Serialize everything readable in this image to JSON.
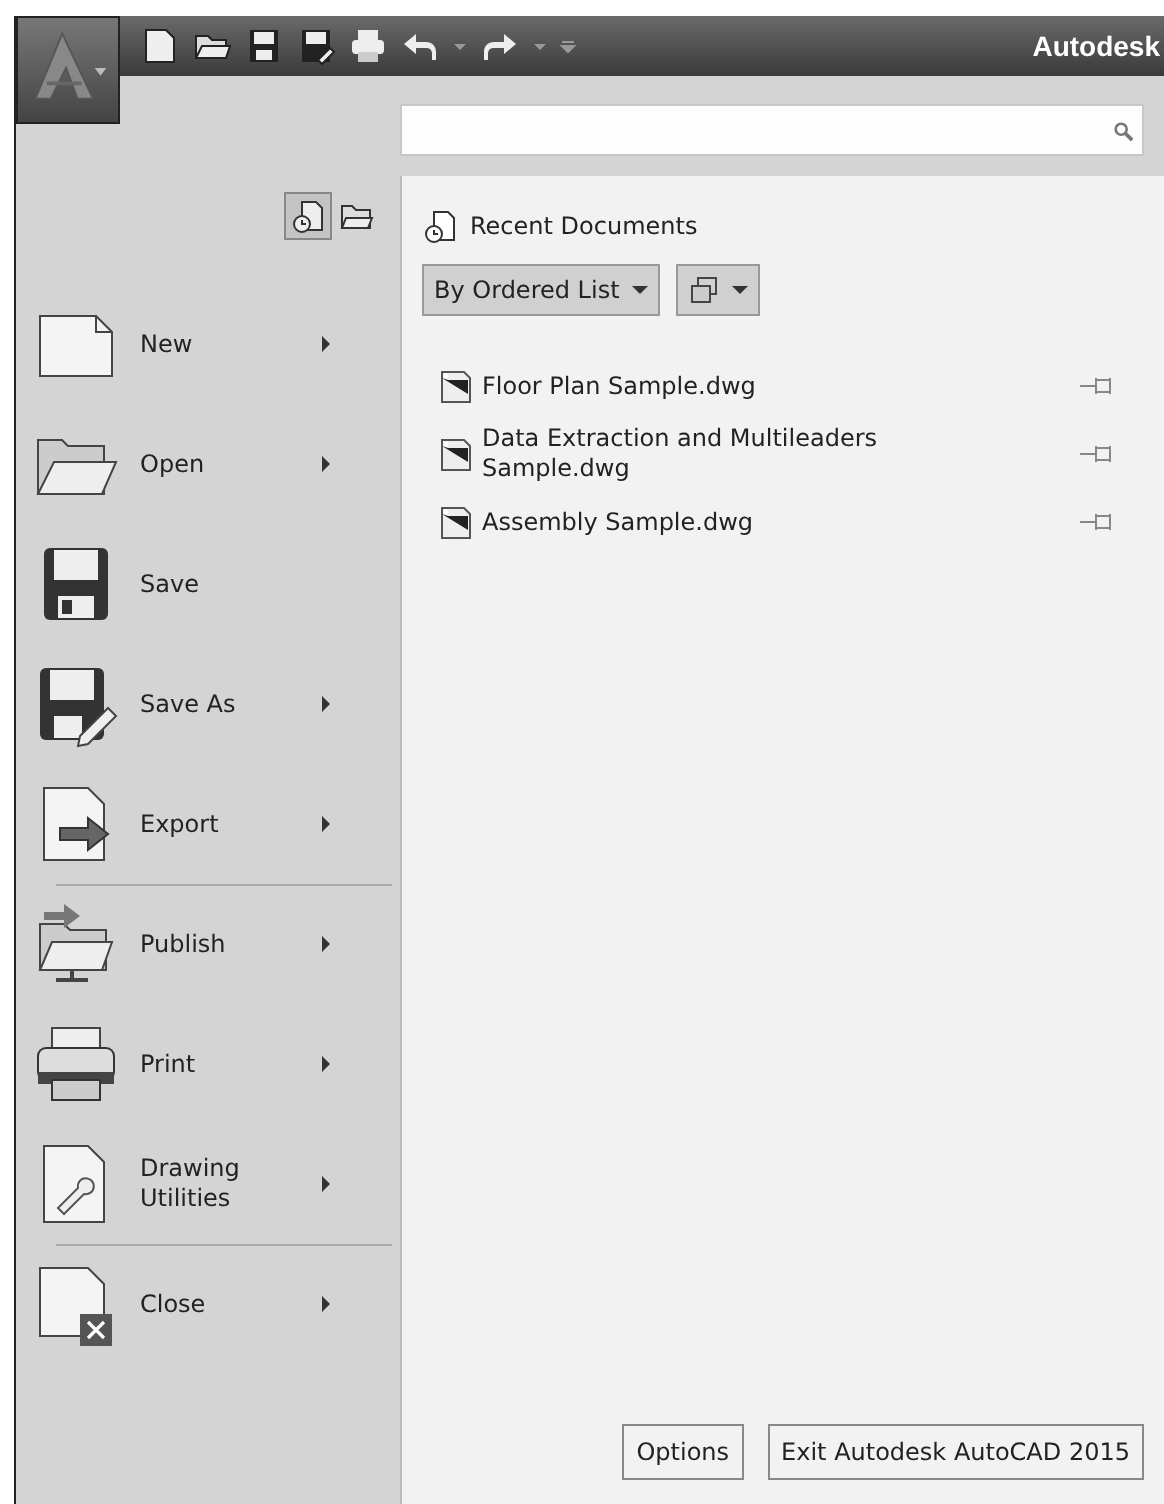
{
  "title_bar": {
    "title": "Autodesk"
  },
  "view_toggle": [
    {
      "kind": "recent",
      "selected": true
    },
    {
      "kind": "open",
      "selected": false
    }
  ],
  "menu": [
    {
      "kind": "new",
      "label": "New",
      "submenu": true,
      "separator_before": false
    },
    {
      "kind": "open",
      "label": "Open",
      "submenu": true,
      "separator_before": false
    },
    {
      "kind": "save",
      "label": "Save",
      "submenu": false,
      "separator_before": false
    },
    {
      "kind": "saveas",
      "label": "Save As",
      "submenu": true,
      "separator_before": false
    },
    {
      "kind": "export",
      "label": "Export",
      "submenu": true,
      "separator_before": false
    },
    {
      "kind": "publish",
      "label": "Publish",
      "submenu": true,
      "separator_before": true
    },
    {
      "kind": "print",
      "label": "Print",
      "submenu": true,
      "separator_before": false
    },
    {
      "kind": "utilities",
      "label": "Drawing Utilities",
      "submenu": true,
      "separator_before": false
    },
    {
      "kind": "close",
      "label": "Close",
      "submenu": true,
      "separator_before": true
    }
  ],
  "recent": {
    "title": "Recent Documents",
    "sort": "By Ordered List",
    "documents": [
      {
        "name": "Floor Plan Sample.dwg"
      },
      {
        "name": "Data Extraction and Multileaders Sample.dwg"
      },
      {
        "name": "Assembly Sample.dwg"
      }
    ]
  },
  "buttons": [
    "Options",
    "Exit Autodesk AutoCAD 2015"
  ]
}
